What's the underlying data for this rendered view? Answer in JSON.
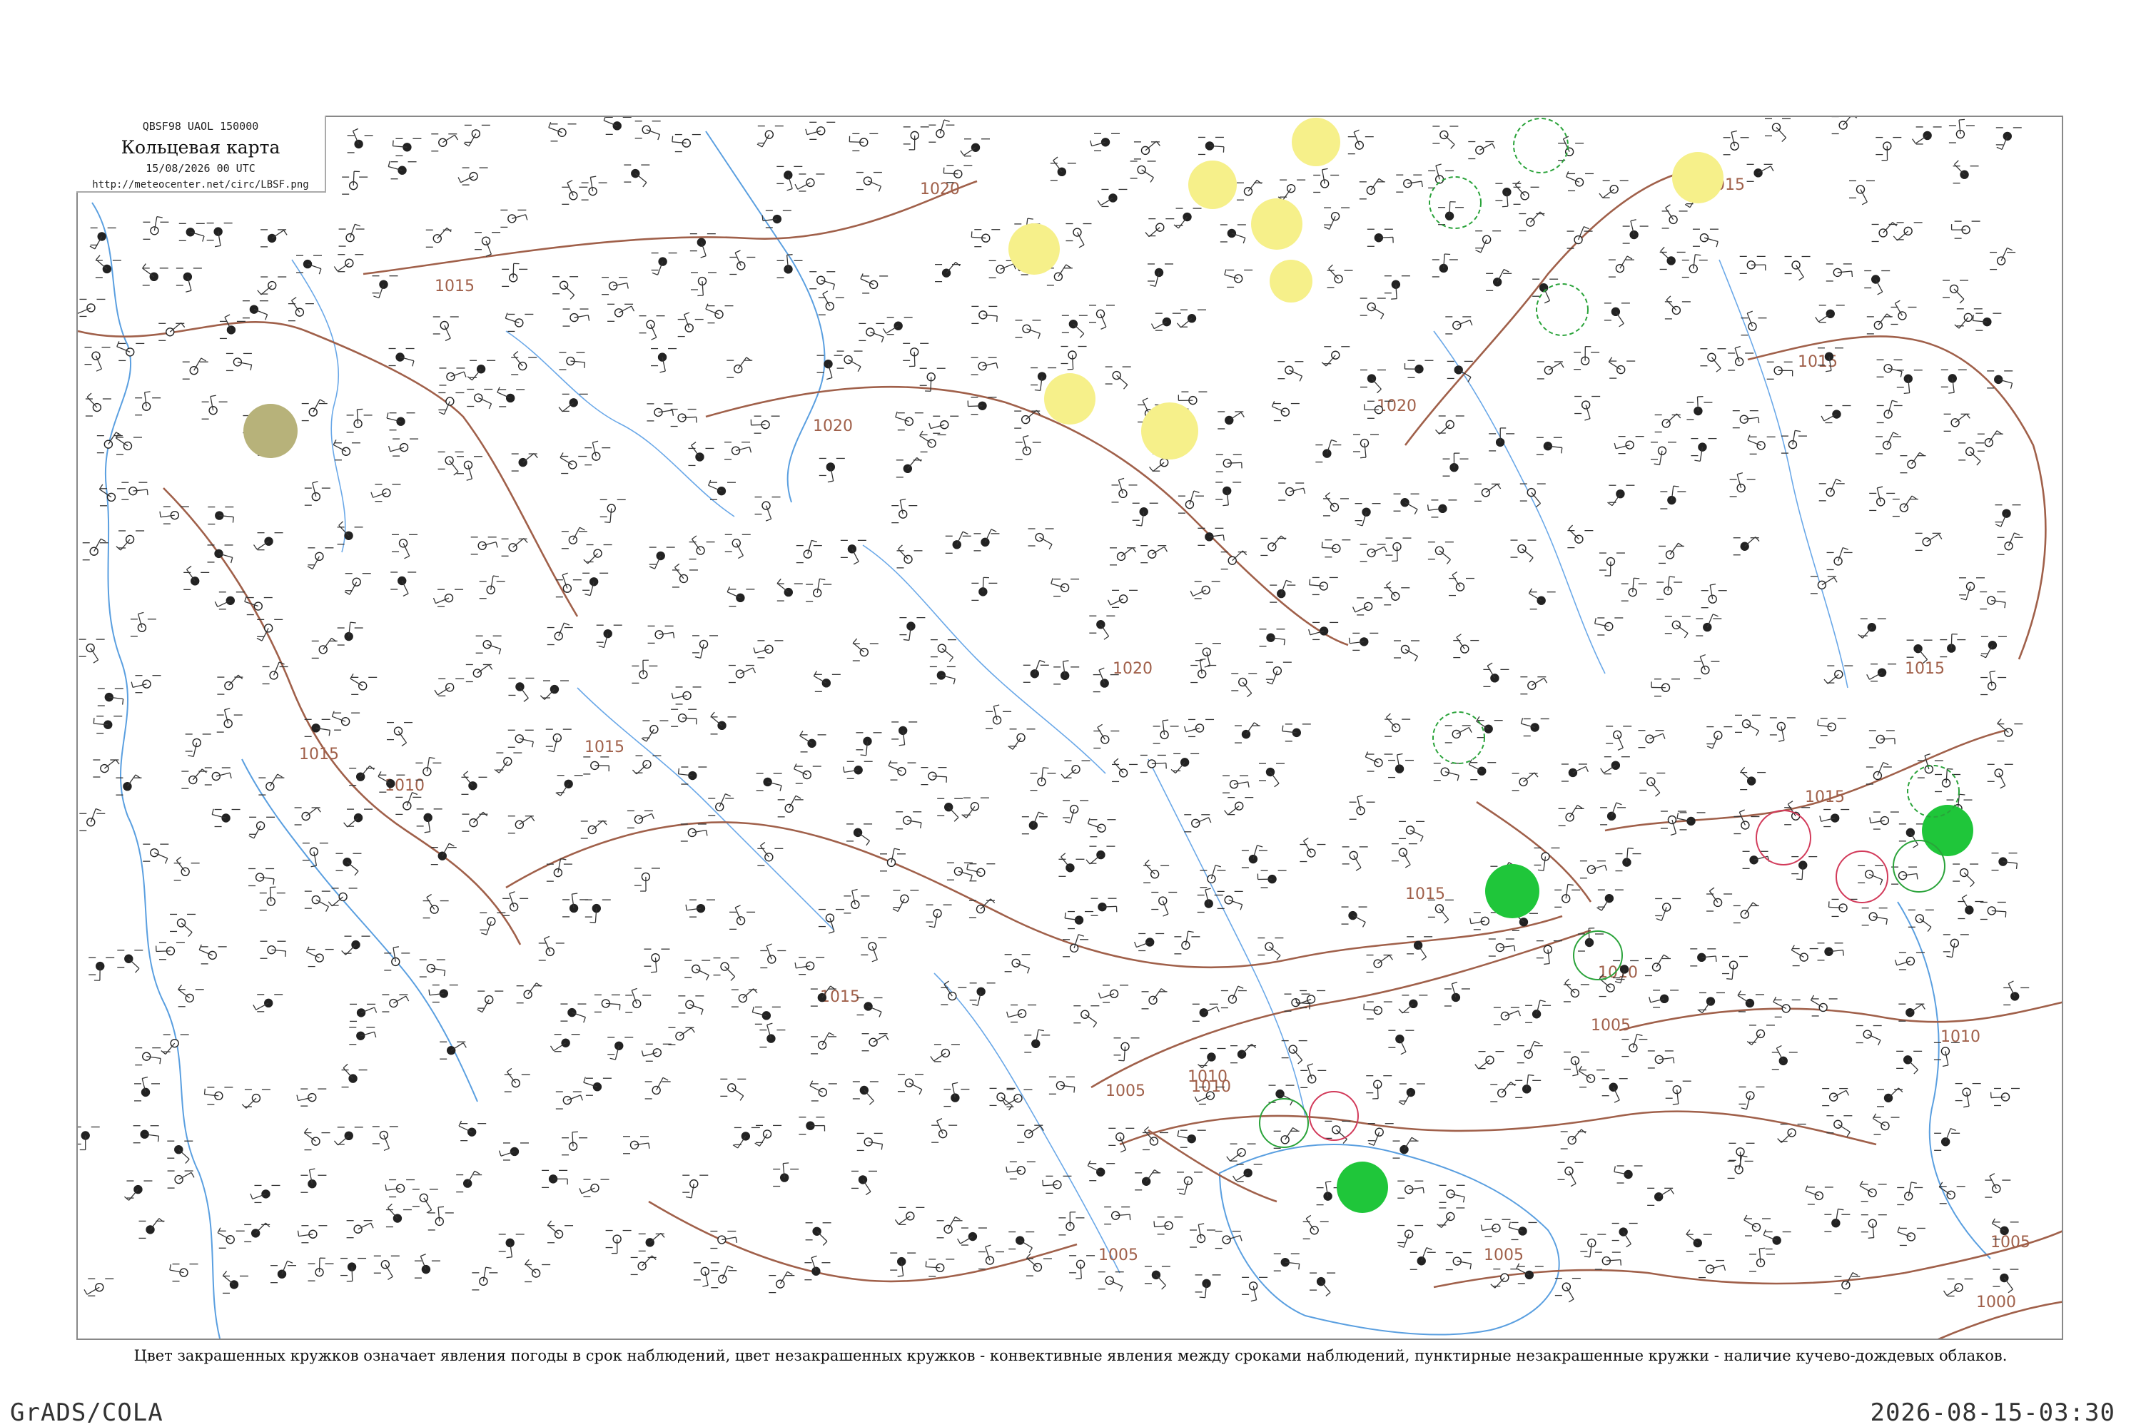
{
  "legend": {
    "code_line": "QBSF98  UAOL  150000",
    "title": "Кольцевая карта",
    "time": "15/08/2026 00 UTC",
    "url": "http://meteocenter.net/circ/LBSF.png"
  },
  "caption": "Цвет закрашенных кружков означает явления погоды в срок наблюдений, цвет незакрашенных кружков - конвективные явления между сроками наблюдений, пунктирные незакрашенные кружки - наличие кучево-дождевых облаков.",
  "footer": {
    "left": "GrADS/COLA",
    "right": "2026-08-15-03:30"
  },
  "isobar_labels": [
    "1020",
    "1015",
    "1015",
    "1020",
    "1020",
    "1015",
    "1020",
    "1015",
    "1015",
    "1015",
    "1010",
    "1015",
    "1015",
    "1010",
    "1010",
    "1005",
    "1005",
    "1005",
    "1005",
    "1000",
    "1010",
    "1015",
    "1010",
    "1005"
  ],
  "colors": {
    "isobar": "#a0604a",
    "water": "#5a9fe0",
    "weather_green": "#1fc63a",
    "weather_yellow": "#f6f08a",
    "weather_olive": "#b7b27a",
    "convective_green": "#2aa33a",
    "convective_red": "#d23a5a"
  }
}
